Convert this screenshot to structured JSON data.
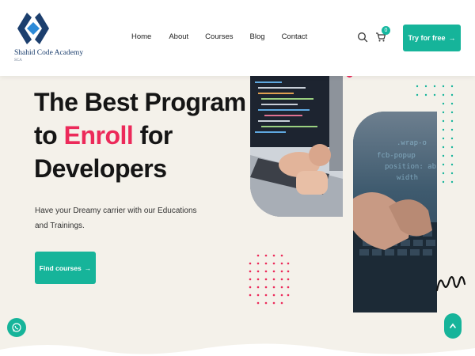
{
  "brand": {
    "name": "Shahid Code Academy",
    "tagline": "SCA"
  },
  "nav": {
    "items": [
      "Home",
      "About",
      "Courses",
      "Blog",
      "Contact"
    ]
  },
  "header": {
    "cart_count": "0",
    "cta_label": "Try for free"
  },
  "hero": {
    "headline_line1": "The Best Program",
    "headline_line2_pre": "to ",
    "headline_line2_accent": "Enroll",
    "headline_line2_post": " for",
    "headline_line3": "Developers",
    "subtext": "Have your Dreamy carrier with our Educations and Trainings.",
    "cta_label": "Find courses"
  },
  "colors": {
    "accent_teal": "#16b49a",
    "accent_pink": "#ec2a5a",
    "background": "#f4f1ea"
  },
  "icons": {
    "search": "search-icon",
    "cart": "cart-icon",
    "arrow": "arrow-right-icon",
    "whatsapp": "whatsapp-icon",
    "scroll_top": "chevron-up-icon"
  }
}
